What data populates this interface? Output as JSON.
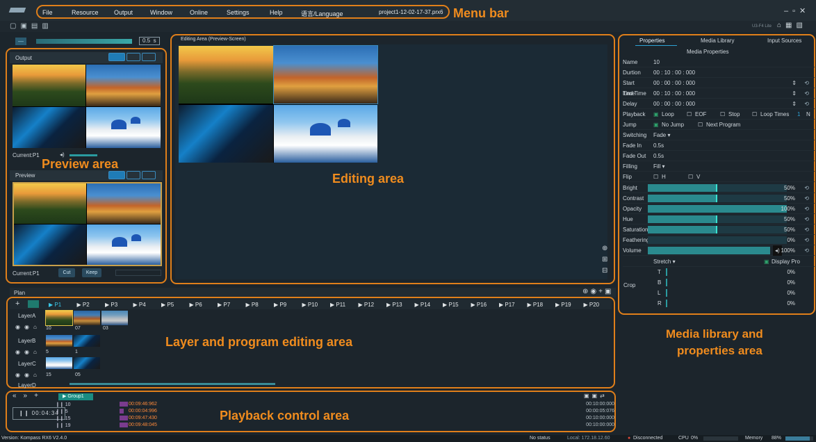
{
  "menubar": {
    "items": [
      "File",
      "Resource",
      "Output",
      "Window",
      "Online",
      "Settings",
      "Help",
      "语言/Language"
    ],
    "project": "project1-12-02-17-37.prx6",
    "device": "U3-F4 Lite"
  },
  "annotations": {
    "menu_bar": "Menu bar",
    "preview_area": "Preview area",
    "editing_area": "Editing area",
    "layer_area": "Layer and program editing area",
    "playback_area": "Playback control area",
    "media_area_line1": "Media library and",
    "media_area_line2": "properties area"
  },
  "preview": {
    "transition_value": "0.5",
    "transition_unit": "s",
    "output_label": "Output",
    "preview_label": "Preview",
    "current_output": "Current:P1",
    "current_preview": "Current:P1",
    "cut_label": "Cut",
    "keep_label": "Keep"
  },
  "editing": {
    "title": "Editing Area (Preview-Screen)"
  },
  "plan": {
    "title": "Plan",
    "programs": [
      "P1",
      "P2",
      "P3",
      "P4",
      "P5",
      "P6",
      "P7",
      "P8",
      "P9",
      "P10",
      "P11",
      "P12",
      "P13",
      "P14",
      "P15",
      "P16",
      "P17",
      "P18",
      "P19",
      "P20"
    ],
    "layers": [
      {
        "name": "LayerA",
        "nums": [
          "10",
          "07",
          "03"
        ]
      },
      {
        "name": "LayerB",
        "nums": [
          "5",
          "1"
        ]
      },
      {
        "name": "LayerC",
        "nums": [
          "15",
          "05"
        ]
      },
      {
        "name": "LayerD",
        "nums": []
      }
    ]
  },
  "playback": {
    "group": "Group1",
    "timer": "00:04:34",
    "items": [
      {
        "num": "10",
        "time": "00:09:46:962",
        "total": "00:10:00:000"
      },
      {
        "num": "5",
        "time": "00:00:04:996",
        "total": "00:00:05:076"
      },
      {
        "num": "15",
        "time": "00:09:47:430",
        "total": "00:10:00:000"
      },
      {
        "num": "19",
        "time": "00:09:48:045",
        "total": "00:10:00:000"
      }
    ]
  },
  "media": {
    "tabs": [
      "Properties",
      "Media Library",
      "Input Sources"
    ],
    "heading": "Media Properties",
    "name_label": "Name",
    "name_value": "10",
    "duration_label": "Durtion",
    "duration_value": "00 : 10 : 00 : 000",
    "start_label": "Start Time",
    "start_value": "00 : 00 : 00 : 000",
    "end_label": "End Time",
    "end_value": "00 : 10 : 00 : 000",
    "delay_label": "Delay",
    "delay_value": "00 : 00 : 00 : 000",
    "playback_label": "Playback",
    "loop": "Loop",
    "eof": "EOF",
    "stop": "Stop",
    "loop_times": "Loop Times",
    "loop_times_value": "1",
    "loop_times_unit": "N",
    "jump_label": "Jump",
    "no_jump": "No Jump",
    "next_program": "Next Program",
    "switching_label": "Switching",
    "switching_value": "Fade",
    "fade_in_label": "Fade In",
    "fade_in_value": "0.5s",
    "fade_out_label": "Fade Out",
    "fade_out_value": "0.5s",
    "filling_label": "Filling",
    "filling_value": "Fill",
    "flip_label": "Flip",
    "flip_h": "H",
    "flip_v": "V",
    "sliders": [
      {
        "label": "Bright",
        "value": "50%",
        "level": 0.5
      },
      {
        "label": "Contrast",
        "value": "50%",
        "level": 0.5
      },
      {
        "label": "Opacity",
        "value": "100%",
        "level": 1.0
      },
      {
        "label": "Hue",
        "value": "50%",
        "level": 0.5
      },
      {
        "label": "Saturation",
        "value": "50%",
        "level": 0.5
      },
      {
        "label": "Feathering",
        "value": "0%",
        "level": 0.0
      }
    ],
    "volume_label": "Volume",
    "volume_value": "100%",
    "stretch_label": "Stretch",
    "display_pro": "Display Pro",
    "crop_label": "Crop",
    "crop": [
      {
        "k": "T",
        "v": "0%"
      },
      {
        "k": "B",
        "v": "0%"
      },
      {
        "k": "L",
        "v": "0%"
      },
      {
        "k": "R",
        "v": "0%"
      }
    ]
  },
  "status": {
    "version": "Version: Kompass RX6 V2.4.0",
    "no_status": "No status",
    "local": "Local: 172.18.12.60",
    "disconnected": "Disconnected",
    "cpu_label": "CPU",
    "cpu_value": "0%",
    "memory_label": "Memory",
    "memory_value": "88%"
  }
}
